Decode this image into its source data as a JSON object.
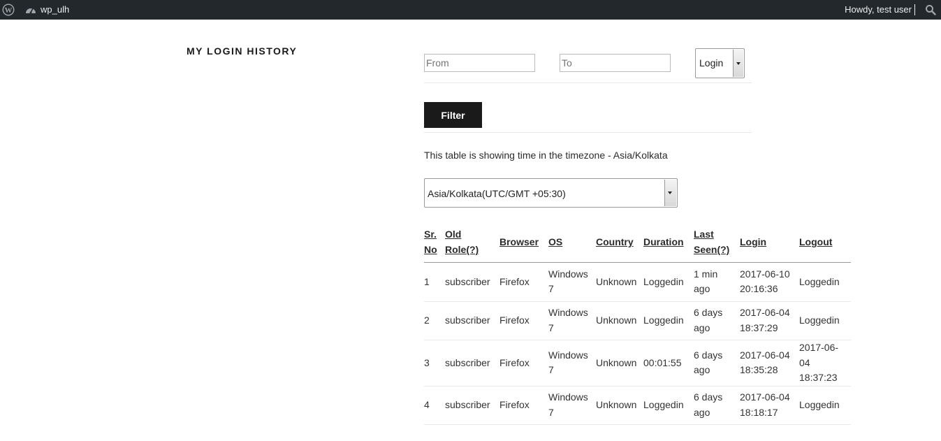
{
  "adminbar": {
    "site_name": "wp_ulh",
    "howdy": "Howdy, test user",
    "icons": [
      "wordpress-logo-icon",
      "dashboard-icon",
      "search-icon"
    ]
  },
  "page_title": "MY LOGIN HISTORY",
  "filters": {
    "from_placeholder": "From",
    "to_placeholder": "To",
    "type_select": "Login",
    "filter_button": "Filter"
  },
  "timezone": {
    "info_text": "This table is showing time in the timezone - Asia/Kolkata",
    "selected": "Asia/Kolkata(UTC/GMT +05:30)"
  },
  "table": {
    "headers": [
      [
        "Sr.",
        "No"
      ],
      [
        "Old",
        "Role(?)"
      ],
      [
        "Browser"
      ],
      [
        "OS"
      ],
      [
        "Country"
      ],
      [
        "Duration"
      ],
      [
        "Last",
        "Seen(?)"
      ],
      [
        "Login"
      ],
      [
        "Logout"
      ]
    ],
    "rows": [
      [
        [
          "1"
        ],
        [
          "subscriber"
        ],
        [
          "Firefox"
        ],
        [
          "Windows",
          "7"
        ],
        [
          "Unknown"
        ],
        [
          "Loggedin"
        ],
        [
          "1 min",
          "ago"
        ],
        [
          "2017-06-10",
          "20:16:36"
        ],
        [
          "Loggedin"
        ]
      ],
      [
        [
          "2"
        ],
        [
          "subscriber"
        ],
        [
          "Firefox"
        ],
        [
          "Windows",
          "7"
        ],
        [
          "Unknown"
        ],
        [
          "Loggedin"
        ],
        [
          "6 days",
          "ago"
        ],
        [
          "2017-06-04",
          "18:37:29"
        ],
        [
          "Loggedin"
        ]
      ],
      [
        [
          "3"
        ],
        [
          "subscriber"
        ],
        [
          "Firefox"
        ],
        [
          "Windows",
          "7"
        ],
        [
          "Unknown"
        ],
        [
          "00:01:55"
        ],
        [
          "6 days",
          "ago"
        ],
        [
          "2017-06-04",
          "18:35:28"
        ],
        [
          "2017-06-04",
          "18:37:23"
        ]
      ],
      [
        [
          "4"
        ],
        [
          "subscriber"
        ],
        [
          "Firefox"
        ],
        [
          "Windows",
          "7"
        ],
        [
          "Unknown"
        ],
        [
          "Loggedin"
        ],
        [
          "6 days",
          "ago"
        ],
        [
          "2017-06-04",
          "18:18:17"
        ],
        [
          "Loggedin"
        ]
      ]
    ]
  }
}
